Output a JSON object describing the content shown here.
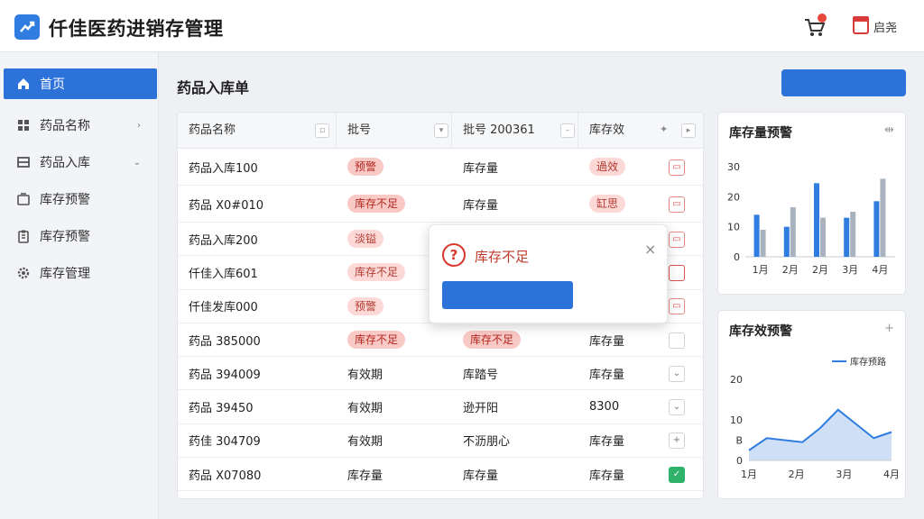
{
  "app": {
    "title": "仟佳医药进销存管理",
    "user_label": "启尧"
  },
  "sidebar": {
    "items": [
      {
        "label": "首页",
        "icon": "home-icon",
        "active": true
      },
      {
        "label": "药品名称",
        "icon": "grid-icon"
      },
      {
        "label": "药品入库",
        "icon": "inbox-icon"
      },
      {
        "label": "库存预警",
        "icon": "box-icon"
      },
      {
        "label": "库存预警",
        "icon": "clipboard-icon"
      },
      {
        "label": "库存管理",
        "icon": "gear-icon"
      }
    ]
  },
  "main": {
    "page_title": "药品入库单",
    "table": {
      "headers": [
        "药品名称",
        "批号",
        "批号 200361",
        "库存效"
      ],
      "rows": [
        {
          "name": "药品入库100",
          "c2": "预警",
          "c2_pill": "red",
          "c3": "库存量",
          "c3_pill": "",
          "c4": "過效",
          "c4_pill": "pink",
          "action": "doc"
        },
        {
          "name": "药品 X0#010",
          "c2": "库存不足",
          "c2_pill": "red",
          "c3": "库存量",
          "c3_pill": "",
          "c4": "缸思",
          "c4_pill": "pink",
          "action": "doc"
        },
        {
          "name": "药品入库200",
          "c2": "淡镒",
          "c2_pill": "pink",
          "c3": "",
          "c3_pill": "",
          "c4": "",
          "c4_pill": "",
          "action": "doc"
        },
        {
          "name": "仟佳入库601",
          "c2": "库存不足",
          "c2_pill": "pink",
          "c3": "",
          "c3_pill": "",
          "c4": "",
          "c4_pill": "",
          "action": "red"
        },
        {
          "name": "仟佳发库000",
          "c2": "预警",
          "c2_pill": "pink",
          "c3": "",
          "c3_pill": "",
          "c4": "",
          "c4_pill": "",
          "action": "doc"
        },
        {
          "name": "药品 385000",
          "c2": "库存不足",
          "c2_pill": "red",
          "c3": "库存不足",
          "c3_pill": "red",
          "c4": "库存量",
          "c4_pill": "",
          "action": "blank"
        },
        {
          "name": "药品 394009",
          "c2": "有效期",
          "c2_pill": "",
          "c3": "库踏号",
          "c3_pill": "",
          "c4": "库存量",
          "c4_pill": "",
          "action": "chev"
        },
        {
          "name": "药品 39450",
          "c2": "有效期",
          "c2_pill": "",
          "c3": "逊开阳",
          "c3_pill": "",
          "c4": "8300",
          "c4_pill": "",
          "action": "chev"
        },
        {
          "name": "药佳 304709",
          "c2": "有效期",
          "c2_pill": "",
          "c3": "不沥朋心",
          "c3_pill": "",
          "c4": "库存量",
          "c4_pill": "",
          "action": "plus"
        },
        {
          "name": "药品 X07080",
          "c2": "库存量",
          "c2_pill": "",
          "c3": "库存量",
          "c3_pill": "",
          "c4": "库存量",
          "c4_pill": "",
          "action": "green"
        }
      ]
    },
    "dialog": {
      "title": "库存不足",
      "close": "×"
    }
  },
  "colors": {
    "primary": "#2d72d9",
    "bar_blue": "#2f7de1",
    "bar_gray": "#a9b3bf",
    "danger": "#d9362c"
  },
  "bar_card": {
    "title": "库存量预警"
  },
  "line_card": {
    "title": "库存效预警",
    "legend": "库存预路"
  },
  "chart_data": [
    {
      "type": "bar",
      "title": "库存量预警",
      "categories": [
        "1月",
        "2月",
        "2月",
        "3月",
        "4月"
      ],
      "series": [
        {
          "values": [
            14,
            10,
            24.5,
            13,
            18.5
          ]
        },
        {
          "values": [
            9,
            16.5,
            13,
            15,
            26
          ]
        }
      ],
      "yticks": [
        0,
        10,
        20,
        30
      ],
      "ylim": [
        0,
        30
      ]
    },
    {
      "type": "area",
      "title": "库存效预警",
      "categories": [
        "1月",
        "2月",
        "3月",
        "4月"
      ],
      "x": [
        0,
        0.5,
        1,
        1.5,
        2,
        2.5,
        3,
        3.5,
        4
      ],
      "series": [
        {
          "name": "库存预路",
          "values": [
            2.5,
            5.5,
            5,
            4.5,
            8,
            12.5,
            9,
            5.5,
            7
          ]
        }
      ],
      "yticks": [
        "0",
        "B",
        "10",
        "20"
      ],
      "ylim": [
        0,
        20
      ]
    }
  ]
}
